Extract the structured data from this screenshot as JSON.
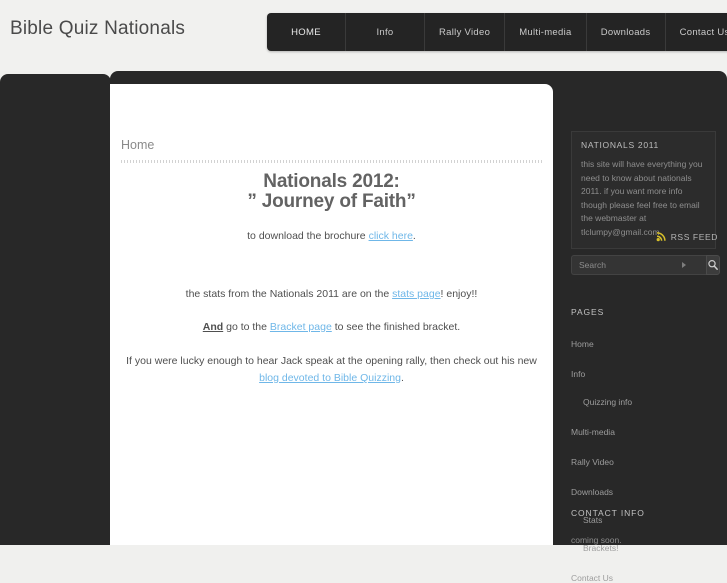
{
  "header": {
    "site_title": "Bible Quiz Nationals"
  },
  "nav": {
    "items": [
      {
        "label": "HOME",
        "active": true
      },
      {
        "label": "Info",
        "active": false
      },
      {
        "label": "Rally Video",
        "active": false
      },
      {
        "label": "Multi-media",
        "active": false
      },
      {
        "label": "Downloads",
        "active": false
      },
      {
        "label": "Contact Us",
        "active": false
      }
    ]
  },
  "content": {
    "breadcrumb": "Home",
    "title_line1": "Nationals 2012:",
    "title_line2": "” Journey of Faith”",
    "brochure": {
      "prefix": "to download the brochure ",
      "link": "click here",
      "suffix": "."
    },
    "stats": {
      "prefix": "the stats from the Nationals 2011 are on the ",
      "link": "stats page",
      "suffix": "! enjoy!!"
    },
    "bracket": {
      "emphasis": "And",
      "mid": " go to the ",
      "link": "Bracket page",
      "suffix": " to see the finished bracket."
    },
    "blog": {
      "prefix": "If you were lucky enough to hear Jack speak at the opening rally, then check out his new ",
      "link": "blog devoted to Bible Quizzing",
      "suffix": "."
    }
  },
  "sidebar": {
    "nationals_widget": {
      "title": "NATIONALS 2011",
      "body": "this site will have everything you need to know about nationals 2011. if you want more info though please feel free to email the webmaster at tlclumpy@gmail.com"
    },
    "rss": {
      "label": "RSS FEED",
      "icon": "rss-icon",
      "color": "#d7c02a"
    },
    "search": {
      "placeholder": "Search",
      "value": "",
      "button_icon": "magnifier-icon"
    },
    "pages": {
      "title": "PAGES",
      "items": [
        {
          "label": "Home",
          "sub": false
        },
        {
          "label": "Info",
          "sub": false
        },
        {
          "label": "Quizzing info",
          "sub": true
        },
        {
          "label": "Multi-media",
          "sub": false
        },
        {
          "label": "Rally Video",
          "sub": false
        },
        {
          "label": "Downloads",
          "sub": false
        },
        {
          "label": "Stats",
          "sub": true
        },
        {
          "label": "Brackets!",
          "sub": true
        },
        {
          "label": "Contact Us",
          "sub": false
        }
      ]
    },
    "contact": {
      "title": "CONTACT INFO",
      "body": "coming soon."
    }
  },
  "theme": {
    "link_color": "#6fb7e8",
    "dark_bg": "#282828",
    "page_bg": "#f1f1ef",
    "accent_yellow": "#d7c02a"
  }
}
